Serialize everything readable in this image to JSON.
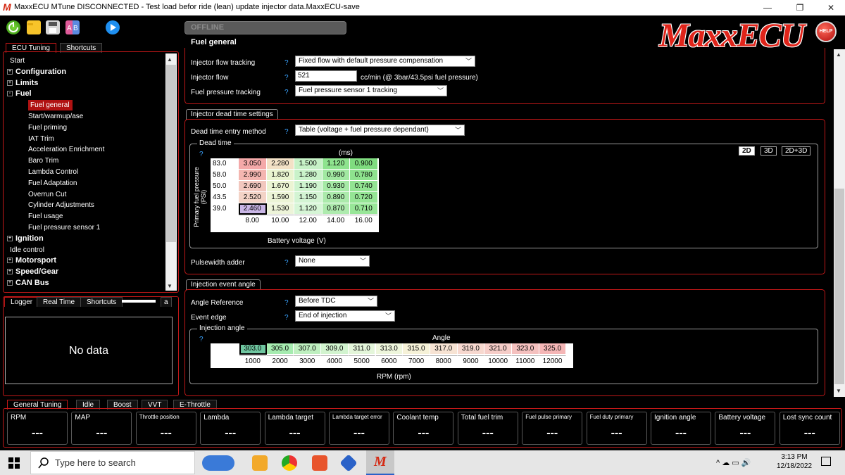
{
  "window": {
    "title": "MaxxECU MTune DISCONNECTED - Test load befor ride (lean) update injector data.MaxxECU-save",
    "minimize": "—",
    "maximize": "❐",
    "close": "✕"
  },
  "toolbar": {
    "status": "OFFLINE",
    "page_title": "Fuel general",
    "brand": "MaxxECU",
    "help": "HELP",
    "icons": [
      "connect-icon",
      "open-folder-icon",
      "save-icon",
      "compare-icon",
      "play-icon"
    ]
  },
  "left_tabs": [
    "ECU Tuning",
    "Shortcuts"
  ],
  "tree": {
    "items": [
      {
        "label": "Start",
        "level": 0,
        "bold": false,
        "expander": ""
      },
      {
        "label": "Configuration",
        "level": 0,
        "bold": true,
        "expander": "+"
      },
      {
        "label": "Limits",
        "level": 0,
        "bold": true,
        "expander": "+"
      },
      {
        "label": "Fuel",
        "level": 0,
        "bold": true,
        "expander": "-"
      },
      {
        "label": "Fuel general",
        "level": 1,
        "selected": true
      },
      {
        "label": "Start/warmup/ase",
        "level": 1
      },
      {
        "label": "Fuel priming",
        "level": 1
      },
      {
        "label": "IAT Trim",
        "level": 1
      },
      {
        "label": "Acceleration Enrichment",
        "level": 1
      },
      {
        "label": "Baro Trim",
        "level": 1
      },
      {
        "label": "Lambda Control",
        "level": 1
      },
      {
        "label": "Fuel Adaptation",
        "level": 1
      },
      {
        "label": "Overrun Cut",
        "level": 1
      },
      {
        "label": "Cylinder Adjustments",
        "level": 1
      },
      {
        "label": "Fuel usage",
        "level": 1
      },
      {
        "label": "Fuel pressure sensor 1",
        "level": 1
      },
      {
        "label": "Ignition",
        "level": 0,
        "bold": true,
        "expander": "+"
      },
      {
        "label": "Idle control",
        "level": 0,
        "bold": false,
        "expander": ""
      },
      {
        "label": "Motorsport",
        "level": 0,
        "bold": true,
        "expander": "+"
      },
      {
        "label": "Speed/Gear",
        "level": 0,
        "bold": true,
        "expander": "+"
      },
      {
        "label": "CAN Bus",
        "level": 0,
        "bold": true,
        "expander": "+"
      }
    ]
  },
  "logger_tabs": [
    "Logger",
    "Real Time",
    "Shortcuts",
    "a"
  ],
  "logger": {
    "empty_text": "No data"
  },
  "injector_flow": {
    "help": "?",
    "tracking_label": "Injector flow tracking",
    "tracking_value": "Fixed flow with default pressure compensation",
    "flow_label": "Injector flow",
    "flow_value": "521",
    "flow_unit": "cc/min (@ 3bar/43.5psi fuel pressure)",
    "pressure_label": "Fuel pressure tracking",
    "pressure_value": "Fuel pressure sensor 1 tracking"
  },
  "dead_time_settings": {
    "group_title": "Injector dead time settings",
    "method_label": "Dead time entry method",
    "method_value": "Table (voltage + fuel pressure dependant)",
    "sub_title": "Dead time",
    "view_buttons": [
      "2D",
      "3D",
      "2D+3D"
    ],
    "pulsewidth_label": "Pulsewidth adder",
    "pulsewidth_value": "None"
  },
  "dead_time_table": {
    "unit": "(ms)",
    "y_axis_label": "Primary fuel pressure (PSI)",
    "x_axis_label": "Battery voltage (V)",
    "rows": [
      "83.0",
      "58.0",
      "50.0",
      "43.5",
      "39.0"
    ],
    "cols": [
      "8.00",
      "10.00",
      "12.00",
      "14.00",
      "16.00"
    ],
    "values": [
      [
        "3.050",
        "2.280",
        "1.500",
        "1.120",
        "0.900"
      ],
      [
        "2.990",
        "1.820",
        "1.280",
        "0.990",
        "0.780"
      ],
      [
        "2.690",
        "1.670",
        "1.190",
        "0.930",
        "0.740"
      ],
      [
        "2.520",
        "1.590",
        "1.150",
        "0.890",
        "0.720"
      ],
      [
        "2.460",
        "1.530",
        "1.120",
        "0.870",
        "0.710"
      ]
    ],
    "colors": [
      [
        "#f4a9a9",
        "#f3e1c6",
        "#c6f1c6",
        "#8ee38e",
        "#7fdc7f"
      ],
      [
        "#f4b6b0",
        "#e9f4cf",
        "#c9f2c9",
        "#a2e9a2",
        "#8ee38e"
      ],
      [
        "#f2c7be",
        "#ebf4d3",
        "#cef3ce",
        "#a6eaa6",
        "#92e492"
      ],
      [
        "#f3d3c6",
        "#ecf4d6",
        "#d3f4d3",
        "#abeaab",
        "#95e595"
      ],
      [
        "#c9b6e6",
        "#edf4d9",
        "#d6f5d6",
        "#aeebae",
        "#98e698"
      ]
    ]
  },
  "injection_event": {
    "group_title": "Injection event angle",
    "angle_ref_label": "Angle Reference",
    "angle_ref_value": "Before TDC",
    "edge_label": "Event edge",
    "edge_value": "End of injection",
    "sub_title": "Injection angle",
    "table_title": "Angle",
    "x_axis_label": "RPM (rpm)",
    "angles": [
      "303.0",
      "305.0",
      "307.0",
      "309.0",
      "311.0",
      "313.0",
      "315.0",
      "317.0",
      "319.0",
      "321.0",
      "323.0",
      "325.0"
    ],
    "rpms": [
      "1000",
      "2000",
      "3000",
      "4000",
      "5000",
      "6000",
      "7000",
      "8000",
      "9000",
      "10000",
      "11000",
      "12000"
    ],
    "colors": [
      "#6fc6a0",
      "#a6ecb0",
      "#bff0c0",
      "#d2f4cf",
      "#e4f6da",
      "#eef6dc",
      "#f6f2d8",
      "#f7e3d3",
      "#f7d8cf",
      "#f6cdc8",
      "#f5c1bf",
      "#f5b6b6"
    ]
  },
  "bottom_tabs": [
    "General Tuning",
    "Idle",
    "Boost",
    "VVT",
    "E-Throttle"
  ],
  "gauges": [
    {
      "label": "RPM",
      "value": "---"
    },
    {
      "label": "MAP",
      "value": "---"
    },
    {
      "label": "Throttle position",
      "value": "---"
    },
    {
      "label": "Lambda",
      "value": "---"
    },
    {
      "label": "Lambda target",
      "value": "---"
    },
    {
      "label": "Lambda target error",
      "value": "---"
    },
    {
      "label": "Coolant temp",
      "value": "---"
    },
    {
      "label": "Total fuel trim",
      "value": "---"
    },
    {
      "label": "Fuel pulse primary",
      "value": "---"
    },
    {
      "label": "Fuel duty primary",
      "value": "---"
    },
    {
      "label": "Ignition angle",
      "value": "---"
    },
    {
      "label": "Battery voltage",
      "value": "---"
    },
    {
      "label": "Lost sync count",
      "value": "---"
    }
  ],
  "taskbar": {
    "search_placeholder": "Type here to search",
    "time": "3:13 PM",
    "date": "12/18/2022",
    "tray": "^ ☁ ▭ 🔊"
  }
}
